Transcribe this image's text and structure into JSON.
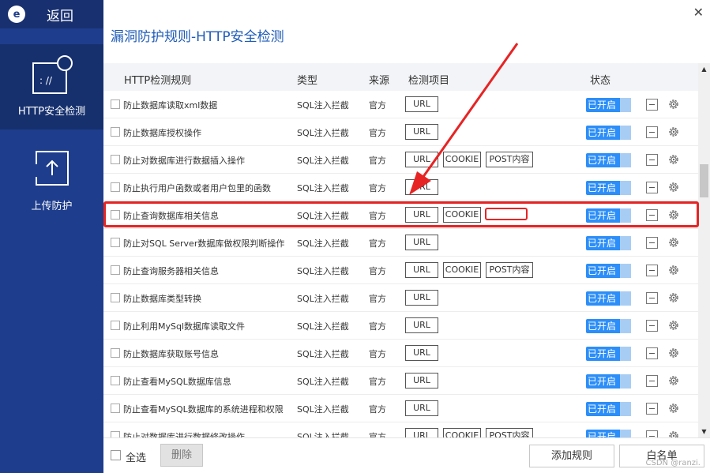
{
  "sidebar": {
    "logo_letter": "e",
    "back_label": "返回",
    "items": [
      {
        "label": "HTTP安全检测",
        "icon": "http-window-icon"
      },
      {
        "label": "上传防护",
        "icon": "upload-icon"
      }
    ]
  },
  "header": {
    "title": "漏洞防护规则-HTTP安全检测",
    "close": "✕"
  },
  "table": {
    "headers": {
      "rule": "HTTP检测规则",
      "type": "类型",
      "source": "来源",
      "items": "检测项目",
      "status": "状态"
    },
    "rows": [
      {
        "name": "防止数据库读取xml数据",
        "type": "SQL注入拦截",
        "source": "官方",
        "url": "URL",
        "cookie": "",
        "post": "",
        "status": "已开启"
      },
      {
        "name": "防止数据库授权操作",
        "type": "SQL注入拦截",
        "source": "官方",
        "url": "URL",
        "cookie": "",
        "post": "",
        "status": "已开启"
      },
      {
        "name": "防止对数据库进行数据插入操作",
        "type": "SQL注入拦截",
        "source": "官方",
        "url": "URL",
        "cookie": "COOKIE",
        "post": "POST内容",
        "status": "已开启"
      },
      {
        "name": "防止执行用户函数或者用户包里的函数",
        "type": "SQL注入拦截",
        "source": "官方",
        "url": "URL",
        "cookie": "",
        "post": "",
        "status": "已开启"
      },
      {
        "name": "防止查询数据库相关信息",
        "type": "SQL注入拦截",
        "source": "官方",
        "url": "URL",
        "cookie": "COOKIE",
        "post": "",
        "status": "已开启"
      },
      {
        "name": "防止对SQL Server数据库做权限判断操作",
        "type": "SQL注入拦截",
        "source": "官方",
        "url": "URL",
        "cookie": "",
        "post": "",
        "status": "已开启"
      },
      {
        "name": "防止查询服务器相关信息",
        "type": "SQL注入拦截",
        "source": "官方",
        "url": "URL",
        "cookie": "COOKIE",
        "post": "POST内容",
        "status": "已开启"
      },
      {
        "name": "防止数据库类型转换",
        "type": "SQL注入拦截",
        "source": "官方",
        "url": "URL",
        "cookie": "",
        "post": "",
        "status": "已开启"
      },
      {
        "name": "防止利用MySql数据库读取文件",
        "type": "SQL注入拦截",
        "source": "官方",
        "url": "URL",
        "cookie": "",
        "post": "",
        "status": "已开启"
      },
      {
        "name": "防止数据库获取账号信息",
        "type": "SQL注入拦截",
        "source": "官方",
        "url": "URL",
        "cookie": "",
        "post": "",
        "status": "已开启"
      },
      {
        "name": "防止查看MySQL数据库信息",
        "type": "SQL注入拦截",
        "source": "官方",
        "url": "URL",
        "cookie": "",
        "post": "",
        "status": "已开启"
      },
      {
        "name": "防止查看MySQL数据库的系统进程和权限",
        "type": "SQL注入拦截",
        "source": "官方",
        "url": "URL",
        "cookie": "",
        "post": "",
        "status": "已开启"
      },
      {
        "name": "防止对数据库进行数据修改操作",
        "type": "SQL注入拦截",
        "source": "官方",
        "url": "URL",
        "cookie": "COOKIE",
        "post": "POST内容",
        "status": "已开启"
      }
    ]
  },
  "footer": {
    "select_all": "全选",
    "delete": "删除",
    "add_rule": "添加规则",
    "whitelist": "白名单",
    "watermark": "CSDN @ranzi."
  },
  "scrollbar": {
    "up": "▲",
    "down": "▼"
  },
  "colors": {
    "sidebar": "#1e3d8c",
    "accent": "#2c8ef8",
    "annotation": "#e62424"
  }
}
